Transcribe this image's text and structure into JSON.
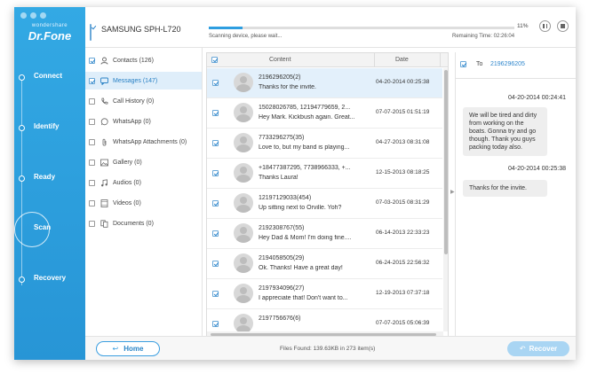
{
  "brand": {
    "small": "wondershare",
    "big": "Dr.Fone"
  },
  "steps": [
    {
      "label": "Connect"
    },
    {
      "label": "Identify"
    },
    {
      "label": "Ready"
    },
    {
      "label": "Scan"
    },
    {
      "label": "Recovery"
    }
  ],
  "header": {
    "device_name": "SAMSUNG SPH-L720",
    "progress_percent": 11,
    "progress_label": "11%",
    "scan_status": "Scanning device, please wait...",
    "remaining_time": "Remaining Time: 02:26:04"
  },
  "categories": [
    {
      "label": "Contacts (126)",
      "icon": "contacts-icon",
      "checked": true
    },
    {
      "label": "Messages (147)",
      "icon": "messages-icon",
      "checked": true,
      "selected": true
    },
    {
      "label": "Call History (0)",
      "icon": "phone-icon",
      "checked": false
    },
    {
      "label": "WhatsApp (0)",
      "icon": "whatsapp-icon",
      "checked": false
    },
    {
      "label": "WhatsApp Attachments (0)",
      "icon": "attachment-icon",
      "checked": false
    },
    {
      "label": "Gallery (0)",
      "icon": "gallery-icon",
      "checked": false
    },
    {
      "label": "Audios (0)",
      "icon": "music-icon",
      "checked": false
    },
    {
      "label": "Videos (0)",
      "icon": "video-icon",
      "checked": false
    },
    {
      "label": "Documents (0)",
      "icon": "documents-icon",
      "checked": false
    }
  ],
  "table": {
    "col_content": "Content",
    "col_date": "Date",
    "rows": [
      {
        "sender": "2196296205(2)",
        "preview": "Thanks for the invite.",
        "date": "04-20-2014 00:25:38",
        "selected": true
      },
      {
        "sender": "15028026785, 12194779659, 2...",
        "preview": "Hey Mark. Kickbush again. Great...",
        "date": "07-07-2015 01:51:19"
      },
      {
        "sender": "7733296275(35)",
        "preview": "Love to, but my band is playing...",
        "date": "04-27-2013 08:31:08"
      },
      {
        "sender": "+18477387295, 7738966333, +...",
        "preview": "Thanks Laura!",
        "date": "12-15-2013 08:18:25"
      },
      {
        "sender": "12197129033(454)",
        "preview": "Up sitting next to Orville. Yoh?",
        "date": "07-03-2015 08:31:29"
      },
      {
        "sender": "2192308767(55)",
        "preview": "Hey Dad & Mom! I'm doing fine....",
        "date": "06-14-2013 22:33:23"
      },
      {
        "sender": "2194058505(29)",
        "preview": "Ok. Thanks! Have a great day!",
        "date": "06-24-2015 22:56:32"
      },
      {
        "sender": "2197934096(27)",
        "preview": "I appreciate that! Don't want to...",
        "date": "12-19-2013 07:37:18"
      },
      {
        "sender": "2197756676(6)",
        "preview": "",
        "date": "07-07-2015 05:06:39"
      }
    ]
  },
  "conversation": {
    "to_label": "To",
    "to_number": "2196296205",
    "messages": [
      {
        "date": "04-20-2014 00:24:41",
        "text": "We will be tired and dirty from working on the boats.  Gonna try and go though. Thank you guys packing today also."
      },
      {
        "date": "04-20-2014 00:25:38",
        "text": "Thanks for the invite."
      }
    ]
  },
  "footer": {
    "home_label": "Home",
    "files_found": "Files Found: 139.63KB in 273 item(s)",
    "recover_label": "Recover"
  }
}
